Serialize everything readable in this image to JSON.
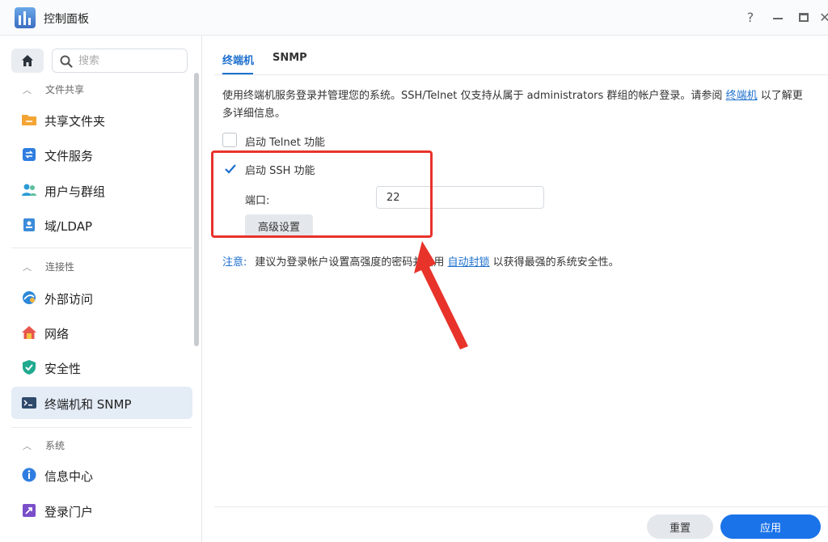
{
  "window": {
    "title": "控制面板",
    "help_glyph": "?",
    "close_glyph": "✕"
  },
  "sidebar": {
    "search_placeholder": "搜索",
    "sections": [
      {
        "title": "文件共享",
        "items": [
          {
            "label": "共享文件夹",
            "icon": "folder-icon"
          },
          {
            "label": "文件服务",
            "icon": "file-services-icon"
          },
          {
            "label": "用户与群组",
            "icon": "users-icon"
          },
          {
            "label": "域/LDAP",
            "icon": "domain-icon"
          }
        ]
      },
      {
        "title": "连接性",
        "items": [
          {
            "label": "外部访问",
            "icon": "external-access-icon"
          },
          {
            "label": "网络",
            "icon": "network-home-icon"
          },
          {
            "label": "安全性",
            "icon": "shield-icon"
          },
          {
            "label": "终端机和 SNMP",
            "icon": "terminal-icon",
            "active": true
          }
        ]
      },
      {
        "title": "系统",
        "items": [
          {
            "label": "信息中心",
            "icon": "info-icon"
          },
          {
            "label": "登录门户",
            "icon": "login-portal-icon"
          }
        ]
      }
    ]
  },
  "main": {
    "tabs": [
      {
        "label": "终端机",
        "active": true
      },
      {
        "label": "SNMP",
        "active": false
      }
    ],
    "description": {
      "line1_before_link": "使用终端机服务登录并管理您的系统。SSH/Telnet 仅支持从属于 administrators 群组的帐户登录。请参阅 ",
      "link": "终端机",
      "line1_after_link": " 以了解更",
      "line2": "多详细信息。"
    },
    "telnet": {
      "label": "启动 Telnet 功能",
      "checked": false
    },
    "ssh": {
      "label": "启动 SSH 功能",
      "checked": true
    },
    "port": {
      "label": "端口:",
      "value": "22"
    },
    "advanced_button": "高级设置",
    "note": {
      "label": "注意:",
      "text_before_link": "建议为登录帐户设置高强度的密码并启用 ",
      "link": "自动封锁",
      "text_after_link": " 以获得最强的系统安全性。"
    },
    "footer": {
      "reset_label": "重置",
      "apply_label": "应用"
    }
  },
  "colors": {
    "accent": "#1c6fce",
    "apply_button": "#1a73e8",
    "annotation": "#e8332b",
    "active_nav": "#e4ecf6"
  }
}
